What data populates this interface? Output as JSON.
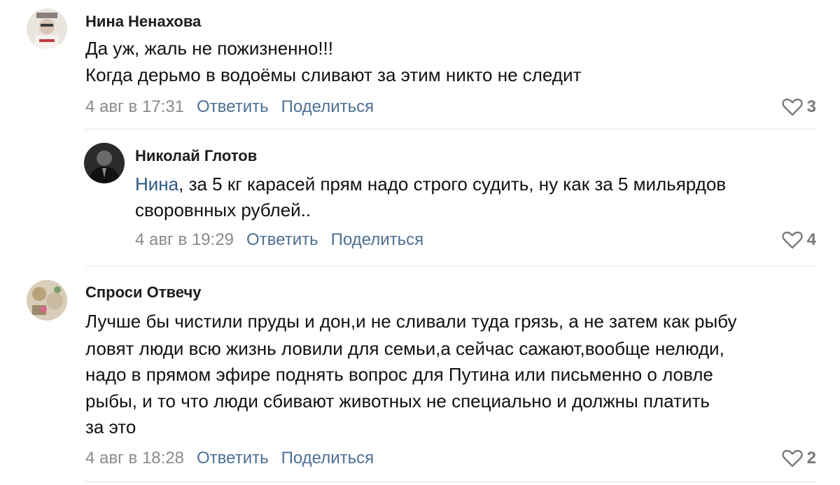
{
  "comments": [
    {
      "author": "Нина Ненахова",
      "lines": [
        "Да уж, жаль не пожизненно!!!",
        "Когда дерьмо в водоёмы сливают за этим никто не следит"
      ],
      "date": "4 авг в 17:31",
      "reply_label": "Ответить",
      "share_label": "Поделиться",
      "likes": "3"
    },
    {
      "author": "Николай Глотов",
      "mention": "Нина",
      "line1_rest": ", за 5 кг карасей прям надо строго судить, ну как за 5 мильярдов",
      "line2": "своровнных рублей..",
      "date": "4 авг в 19:29",
      "reply_label": "Ответить",
      "share_label": "Поделиться",
      "likes": "4"
    },
    {
      "author": "Спроси Отвечу",
      "lines": [
        "Лучше бы чистили пруды и дон,и не сливали туда грязь, а не затем как рыбу",
        "ловят люди всю жизнь ловили для семьи,а сейчас сажают,вообще нелюди,",
        "надо в прямом эфире поднять вопрос для Путина или письменно о ловле",
        "рыбы, и то что люди сбивают животных не специально и должны платить",
        "за это"
      ],
      "date": "4 авг в 18:28",
      "reply_label": "Ответить",
      "share_label": "Поделиться",
      "likes": "2"
    }
  ],
  "colors": {
    "link": "#4d6f94",
    "mention": "#2a5885",
    "meta": "#8a8a8a",
    "divider": "#e2e2e2"
  },
  "icons": {
    "like": "heart-outline-icon"
  }
}
